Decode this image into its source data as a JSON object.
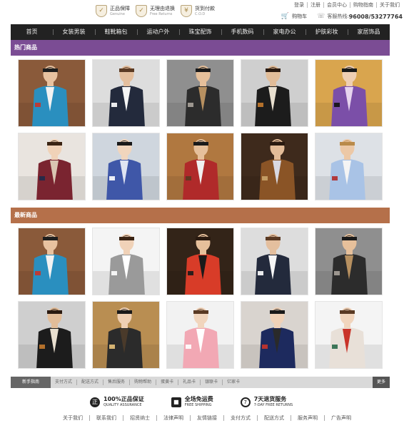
{
  "header": {
    "badges": [
      {
        "icon": "shield-check-icon",
        "glyph": "✓",
        "title": "正品保障",
        "subtitle": "Genuine"
      },
      {
        "icon": "shield-return-icon",
        "glyph": "✓",
        "title": "无理由退换",
        "subtitle": "Free Returns"
      },
      {
        "icon": "cod-icon",
        "glyph": "¥",
        "title": "货到付款",
        "subtitle": "C.O.D"
      }
    ],
    "links": [
      "登录",
      "注册",
      "会员中心",
      "购物指南",
      "关于我们"
    ],
    "cart_label": "购物车",
    "hotline_label": "客服热线:",
    "hotline_number": "96008/53277764"
  },
  "nav": [
    "首页",
    "女装男装",
    "鞋靴箱包",
    "运动户外",
    "珠宝配饰",
    "手机数码",
    "家电办公",
    "护肤彩妆",
    "家居饰品"
  ],
  "sections": {
    "hot": {
      "title": "热门商品",
      "color": "#7b4c94"
    },
    "new": {
      "title": "最新商品",
      "color": "#b5704a"
    }
  },
  "hot_products": [
    {
      "name": "product-blue-jacket-man",
      "bg": "#8a5a3a",
      "top": "#2a8fbf",
      "inner": "#f2f2f2",
      "bottom": "#3b3b3b",
      "skin": "#e8c2a0",
      "hair": "#1e1e1e",
      "extra": "#c9342a"
    },
    {
      "name": "product-navy-jacket-man",
      "bg": "#dddddd",
      "top": "#232a3c",
      "inner": "#f5f5f5",
      "bottom": "#2b2b2b",
      "skin": "#e4bf9e",
      "hair": "#5a3a24",
      "extra": "#ffffff"
    },
    {
      "name": "product-scarf-man",
      "bg": "#8f8f8f",
      "top": "#2c2c2c",
      "inner": "#b79060",
      "bottom": "#2a2a2a",
      "skin": "#e6c09b",
      "hair": "#1a1a1a",
      "extra": "#a8a29a"
    },
    {
      "name": "product-black-jacket-man",
      "bg": "#cfcfcf",
      "top": "#1c1c1c",
      "inner": "#e9e0d0",
      "bottom": "#222222",
      "skin": "#e2bd99",
      "hair": "#2a1a10",
      "extra": "#c47a2e"
    },
    {
      "name": "product-purple-plaid-coat",
      "bg": "#d9a54e",
      "top": "#7b4fa8",
      "inner": "#e6d4ee",
      "bottom": "#4a3a5a",
      "skin": "#efcfb3",
      "hair": "#1a1a1a",
      "extra": "#111111"
    },
    {
      "name": "product-plaid-sweater-woman",
      "bg": "#e9e4df",
      "top": "#7a2430",
      "inner": "#d9c5b2",
      "bottom": "#222222",
      "skin": "#f0d2b8",
      "hair": "#3a2414",
      "extra": "#1f2a4a"
    },
    {
      "name": "product-blue-sweater-woman",
      "bg": "#cfd6de",
      "top": "#3f57a8",
      "inner": "#dfe4f2",
      "bottom": "#1d2a5e",
      "skin": "#f1d5bd",
      "hair": "#1a1a1a",
      "extra": "#ffffff"
    },
    {
      "name": "product-red-sweater-man",
      "bg": "#b07840",
      "top": "#b02a2a",
      "inner": "#f0f0f0",
      "bottom": "#2b2b2b",
      "skin": "#e6c09b",
      "hair": "#1a1a1a",
      "extra": "#5a3a20"
    },
    {
      "name": "product-brown-jacket-man",
      "bg": "#3e2a1c",
      "top": "#8a5426",
      "inner": "#d9d9e2",
      "bottom": "#2b2b3a",
      "skin": "#e3bc98",
      "hair": "#2a1a10",
      "extra": "#c9a46a"
    },
    {
      "name": "product-blue-shirt-man",
      "bg": "#dde1e6",
      "top": "#a9c3e6",
      "inner": "#f4f4f4",
      "bottom": "#7a4a2a",
      "skin": "#ecc8a6",
      "hair": "#b98a4a",
      "extra": "#b02a2a"
    }
  ],
  "new_products": [
    {
      "name": "product-blue-jacket-man-2",
      "bg": "#8a5a3a",
      "top": "#2a8fbf",
      "inner": "#f2f2f2",
      "bottom": "#3b3b3b",
      "skin": "#e8c2a0",
      "hair": "#1e1e1e",
      "extra": "#c9342a"
    },
    {
      "name": "product-stripe-dress-woman",
      "bg": "#f4f4f4",
      "top": "#9a9a9a",
      "inner": "#ffffff",
      "bottom": "#1a1a1a",
      "skin": "#f0d2b8",
      "hair": "#3a2414",
      "extra": "#ffffff"
    },
    {
      "name": "product-red-vneck-man",
      "bg": "#332418",
      "top": "#d83c28",
      "inner": "#1a1a1a",
      "bottom": "#2b2b2b",
      "skin": "#e6c09b",
      "hair": "#2a1a10",
      "extra": "#1a1a1a"
    },
    {
      "name": "product-navy-jacket-man-2",
      "bg": "#dddddd",
      "top": "#232a3c",
      "inner": "#f5f5f5",
      "bottom": "#2b2b2b",
      "skin": "#e4bf9e",
      "hair": "#5a3a24",
      "extra": "#ffffff"
    },
    {
      "name": "product-scarf-man-2",
      "bg": "#8f8f8f",
      "top": "#2c2c2c",
      "inner": "#b79060",
      "bottom": "#2a2a2a",
      "skin": "#e6c09b",
      "hair": "#1a1a1a",
      "extra": "#a8a29a"
    },
    {
      "name": "product-black-jacket-man-2",
      "bg": "#cfcfcf",
      "top": "#1c1c1c",
      "inner": "#e9e0d0",
      "bottom": "#222222",
      "skin": "#e2bd99",
      "hair": "#2a1a10",
      "extra": "#c47a2e"
    },
    {
      "name": "product-street-coat-woman",
      "bg": "#b98e52",
      "top": "#2b2b2b",
      "inner": "#4a3a2a",
      "bottom": "#1a1a1a",
      "skin": "#efcfb3",
      "hair": "#1a1a1a",
      "extra": "#e8c27a"
    },
    {
      "name": "product-pink-sweater-woman",
      "bg": "#f2f2f2",
      "top": "#f2a8b4",
      "inner": "#ffffff",
      "bottom": "#d9cbb8",
      "skin": "#f1d5bd",
      "hair": "#5a3a24",
      "extra": "#ffffff"
    },
    {
      "name": "product-navy-coat-woman",
      "bg": "#d9d4cf",
      "top": "#1d2a5e",
      "inner": "#2a2a2a",
      "bottom": "#1a1a1a",
      "skin": "#f0d2b8",
      "hair": "#1a1a1a",
      "extra": "#c9342a"
    },
    {
      "name": "product-reindeer-sweater-woman",
      "bg": "#f4f4f4",
      "top": "#e8e0d8",
      "inner": "#c9342a",
      "bottom": "#1a1a1a",
      "skin": "#f1d5bd",
      "hair": "#5a3a24",
      "extra": "#2a6a4a"
    }
  ],
  "tabs": {
    "items": [
      "新手指南",
      "支付方式",
      "配送方式",
      "售后服务",
      "购物帮助",
      "蛋黄卡",
      "礼品卡",
      "银联卡",
      "亿家卡"
    ],
    "more": "更多"
  },
  "guarantees": [
    {
      "icon": "genuine-badge-icon",
      "glyph": "正",
      "title": "100%正品保证",
      "subtitle": "QUALITY ASSURANCE"
    },
    {
      "icon": "free-shipping-box-icon",
      "glyph": "■",
      "title": "全场免运费",
      "subtitle": "FREE SHIPPING"
    },
    {
      "icon": "clock-return-icon",
      "glyph": "7",
      "title": "7天退货服务",
      "subtitle": "7-DAY FREE RETURNS"
    }
  ],
  "footer_links": [
    "关于我们",
    "联系我们",
    "招贤纳士",
    "法律声明",
    "友情链接",
    "支付方式",
    "配送方式",
    "服务声明",
    "广告声明"
  ]
}
